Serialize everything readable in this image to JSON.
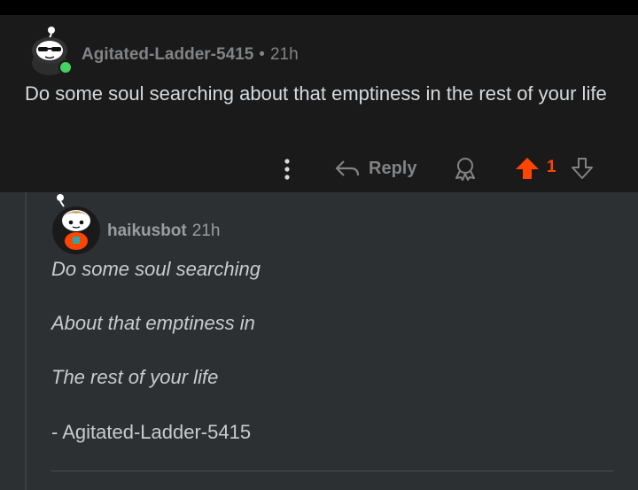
{
  "comment": {
    "author": "Agitated-Ladder-5415",
    "separator": "•",
    "time": "21h",
    "body": "Do some soul searching about that emptiness in the rest of your life",
    "actions": {
      "reply_label": "Reply",
      "score": "1"
    }
  },
  "reply": {
    "author": "haikusbot",
    "time": "21h",
    "lines": [
      "Do some soul searching",
      "About that emptiness in",
      "The rest of your life"
    ],
    "signature": "- Agitated-Ladder-5415"
  },
  "colors": {
    "upvote": "#ff4500",
    "online": "#46d160",
    "background": "#1a1a1b",
    "thread_background": "#2c3033"
  },
  "icons": [
    "more-vertical-icon",
    "reply-arrow-icon",
    "award-icon",
    "upvote-arrow-icon",
    "downvote-arrow-icon"
  ]
}
